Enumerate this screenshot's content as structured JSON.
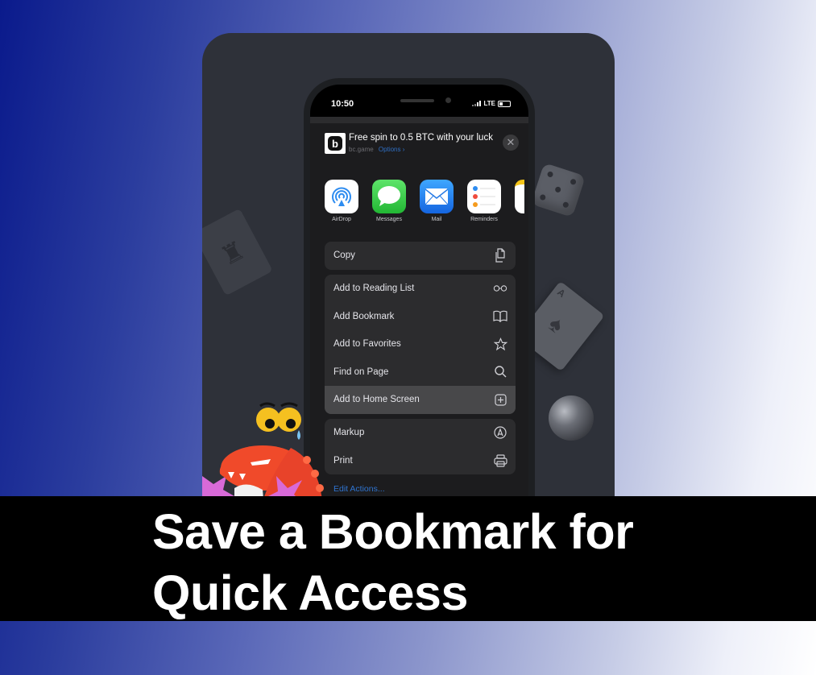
{
  "headline": {
    "line1": "Save a Bookmark for",
    "line2": "Quick Access"
  },
  "phone": {
    "status_bar": {
      "time": "10:50",
      "network": "LTE"
    },
    "share_sheet": {
      "site_title": "Free spin to 0.5 BTC with your luck",
      "site_domain": "bc.game",
      "options_label": "Options",
      "options_chevron": "›",
      "close_icon": "✕",
      "app_icon_letter": "b",
      "apps": [
        {
          "label": "AirDrop",
          "icon": "airdrop-icon"
        },
        {
          "label": "Messages",
          "icon": "messages-icon"
        },
        {
          "label": "Mail",
          "icon": "mail-icon"
        },
        {
          "label": "Reminders",
          "icon": "reminders-icon"
        },
        {
          "label": "",
          "icon": "notes-icon"
        }
      ],
      "actions_group1": [
        {
          "label": "Copy",
          "icon": "copy-icon"
        }
      ],
      "actions_group2": [
        {
          "label": "Add to Reading List",
          "icon": "glasses-icon"
        },
        {
          "label": "Add Bookmark",
          "icon": "book-icon"
        },
        {
          "label": "Add to Favorites",
          "icon": "star-icon"
        },
        {
          "label": "Find on Page",
          "icon": "search-icon"
        },
        {
          "label": "Add to Home Screen",
          "icon": "plus-square-icon",
          "highlighted": true
        }
      ],
      "actions_group3": [
        {
          "label": "Markup",
          "icon": "markup-icon"
        },
        {
          "label": "Print",
          "icon": "printer-icon"
        }
      ],
      "edit_actions_label": "Edit Actions..."
    }
  },
  "colors": {
    "accent_blue": "#2f74d0",
    "banner_bg": "#000000",
    "sheet_bg": "#2c2c2e",
    "highlight_row": "#48484a"
  }
}
